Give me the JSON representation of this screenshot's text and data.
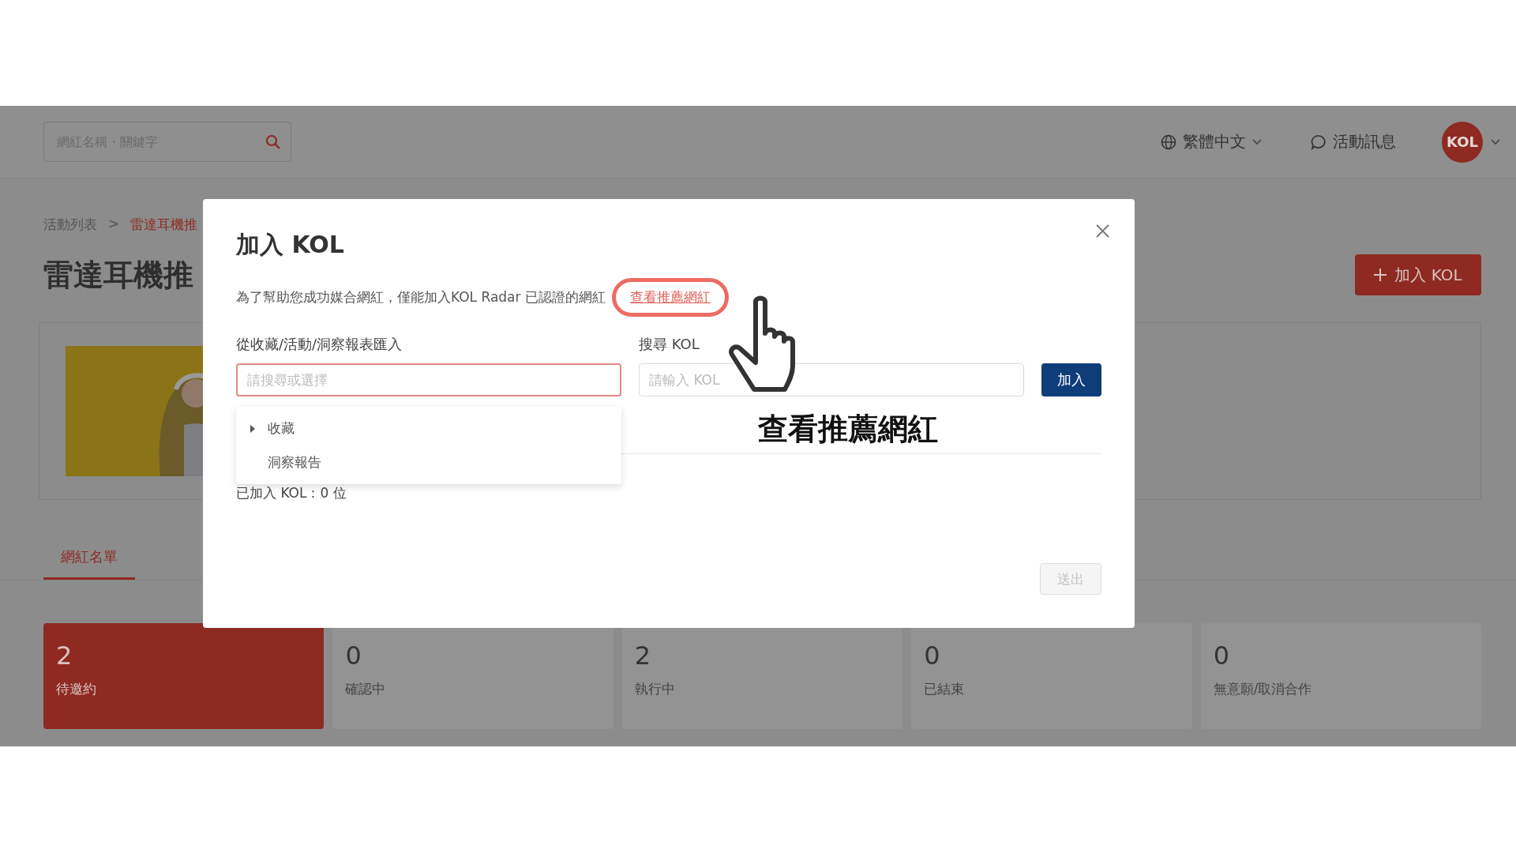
{
  "header": {
    "search": {
      "placeholder": "網紅名稱・關鍵字"
    },
    "language": "繁體中文",
    "messages": "活動訊息",
    "avatar": "KOL"
  },
  "breadcrumb": [
    {
      "label": "活動列表",
      "current": false
    },
    {
      "label": "雷達耳機推",
      "current": true
    }
  ],
  "breadcrumb_separator": ">",
  "page_title": "雷達耳機推",
  "add_button": "加入 KOL",
  "tabs": [
    {
      "label": "網紅名單",
      "selected": true
    }
  ],
  "stats": [
    {
      "count": "2",
      "label": "待邀約",
      "selected": true
    },
    {
      "count": "0",
      "label": "確認中",
      "selected": false
    },
    {
      "count": "2",
      "label": "執行中",
      "selected": false
    },
    {
      "count": "0",
      "label": "已結束",
      "selected": false
    },
    {
      "count": "0",
      "label": "無意願/取消合作",
      "selected": false
    }
  ],
  "modal": {
    "title": "加入 KOL",
    "description": "為了幫助您成功媒合網紅，僅能加入KOL Radar 已認證的網紅",
    "link": "查看推薦網紅",
    "import_label": "從收藏/活動/洞察報表匯入",
    "import_field": {
      "placeholder": "請搜尋或選擇",
      "focused": true
    },
    "dropdown": [
      {
        "label": "收藏",
        "kind": "group"
      },
      {
        "label": "洞察報告",
        "kind": "leaf"
      }
    ],
    "search_label": "搜尋 KOL",
    "search_field": {
      "placeholder": "請輸入 KOL"
    },
    "add": {
      "label": "加入",
      "disabled": false
    },
    "added_count": "已加入 KOL：0 位",
    "submit": {
      "label": "送出",
      "disabled": true
    }
  },
  "annotation": {
    "caption": "查看推薦網紅"
  }
}
